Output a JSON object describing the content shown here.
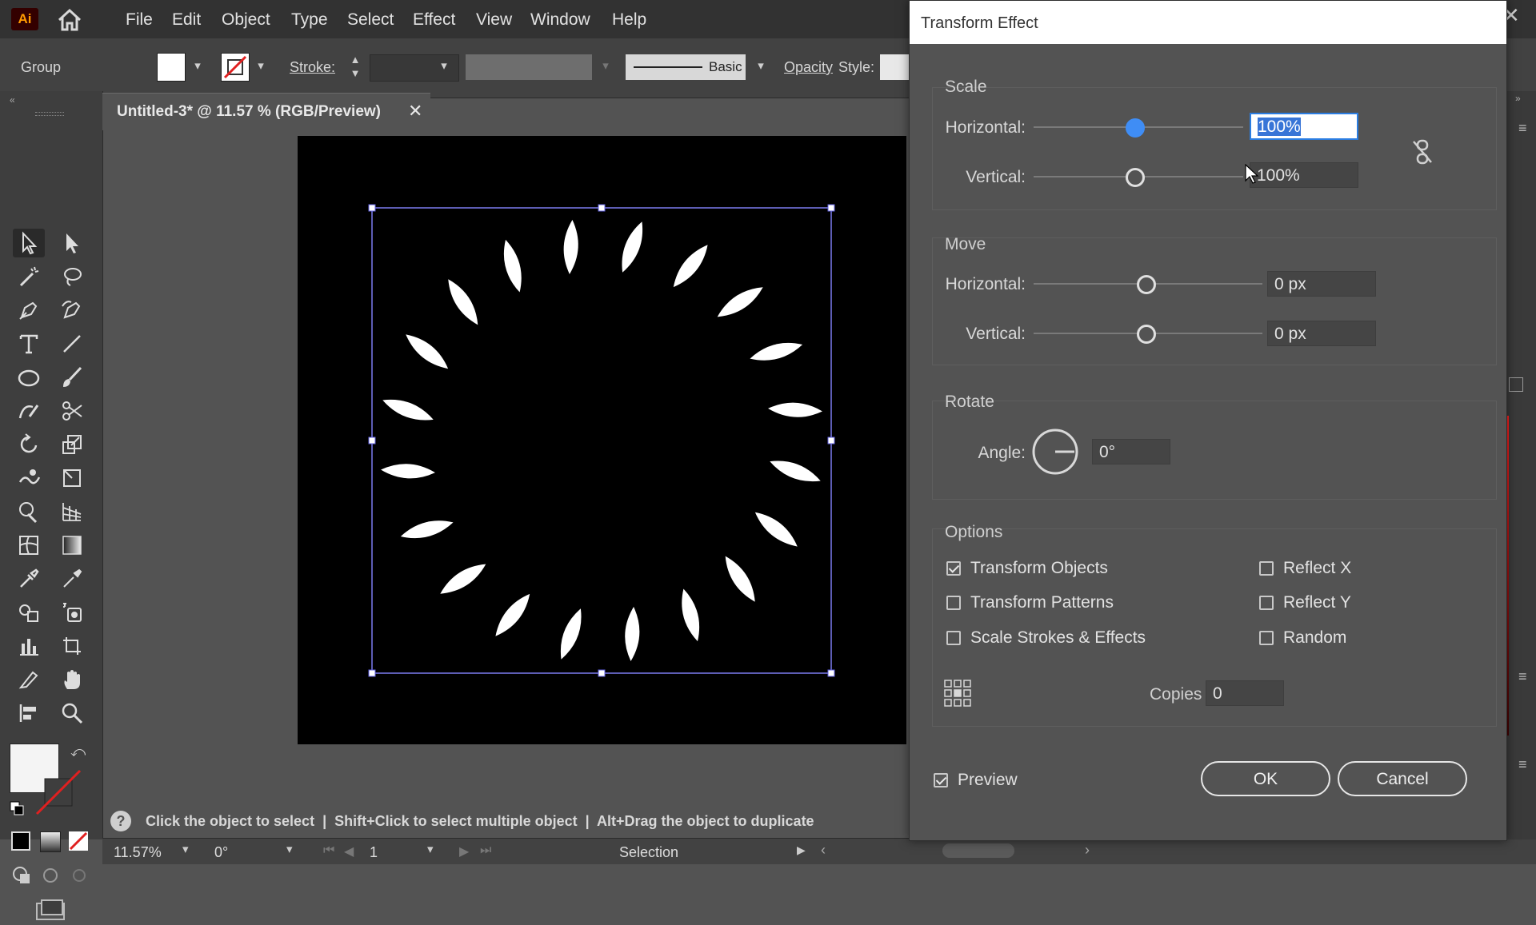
{
  "app": {
    "logo": "Ai"
  },
  "menu": [
    "File",
    "Edit",
    "Object",
    "Type",
    "Select",
    "Effect",
    "View",
    "Window",
    "Help"
  ],
  "control_bar": {
    "selection_type": "Group",
    "stroke_label": "Stroke:",
    "brush_label": "Basic",
    "opacity_label": "Opacity",
    "style_label": "Style:"
  },
  "document_tab": {
    "title": "Untitled-3* @ 11.57 % (RGB/Preview)"
  },
  "status": {
    "hint": "Click the object to select  |  Shift+Click to select multiple object  |  Alt+Drag the object to duplicate",
    "zoom": "11.57%",
    "rotation": "0°",
    "artboard_number": "1",
    "tool_name": "Selection"
  },
  "dialog": {
    "title": "Transform Effect",
    "scale": {
      "label": "Scale",
      "horizontal_label": "Horizontal:",
      "horizontal_value": "100%",
      "vertical_label": "Vertical:",
      "vertical_value": "100%"
    },
    "move": {
      "label": "Move",
      "horizontal_label": "Horizontal:",
      "horizontal_value": "0 px",
      "vertical_label": "Vertical:",
      "vertical_value": "0 px"
    },
    "rotate": {
      "label": "Rotate",
      "angle_label": "Angle:",
      "angle_value": "0°"
    },
    "options": {
      "label": "Options",
      "transform_objects": "Transform Objects",
      "transform_patterns": "Transform Patterns",
      "scale_strokes": "Scale Strokes & Effects",
      "reflect_x": "Reflect X",
      "reflect_y": "Reflect Y",
      "random": "Random"
    },
    "copies_label": "Copies",
    "copies_value": "0",
    "preview_label": "Preview",
    "ok_label": "OK",
    "cancel_label": "Cancel"
  },
  "colors": {
    "accent": "#3f8df5",
    "panel_bg": "#535353",
    "artboard": "#000000",
    "petal": "#ffffff"
  }
}
